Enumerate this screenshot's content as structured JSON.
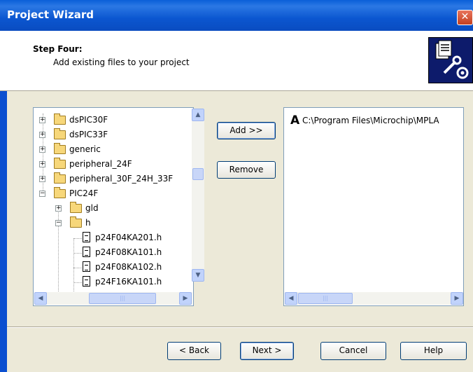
{
  "window": {
    "title": "Project Wizard",
    "close_glyph": "✕"
  },
  "header": {
    "step": "Step Four:",
    "description": "Add existing files to your project",
    "icon": "wizard-files-icon"
  },
  "tree": {
    "items": [
      {
        "label": "dsPIC30F",
        "type": "folder",
        "expander": "+"
      },
      {
        "label": "dsPIC33F",
        "type": "folder",
        "expander": "+"
      },
      {
        "label": "generic",
        "type": "folder",
        "expander": "+"
      },
      {
        "label": "peripheral_24F",
        "type": "folder",
        "expander": "+"
      },
      {
        "label": "peripheral_30F_24H_33F",
        "type": "folder",
        "expander": "+"
      },
      {
        "label": "PIC24F",
        "type": "folder",
        "expander": "−"
      },
      {
        "label": "gld",
        "type": "folder",
        "expander": "+"
      },
      {
        "label": "h",
        "type": "folder",
        "expander": "−"
      },
      {
        "label": "p24F04KA201.h",
        "type": "file"
      },
      {
        "label": "p24F08KA101.h",
        "type": "file"
      },
      {
        "label": "p24F08KA102.h",
        "type": "file"
      },
      {
        "label": "p24F16KA101.h",
        "type": "file"
      }
    ]
  },
  "buttons": {
    "add": "Add >>",
    "remove": "Remove",
    "back": "< Back",
    "next": "Next >",
    "cancel": "Cancel",
    "help": "Help"
  },
  "files": {
    "items": [
      {
        "marker": "A",
        "path": "C:\\Program Files\\Microchip\\MPLA"
      }
    ]
  },
  "scroll": {
    "up": "▲",
    "down": "▼",
    "left": "◀",
    "right": "▶",
    "grip": "|||"
  }
}
